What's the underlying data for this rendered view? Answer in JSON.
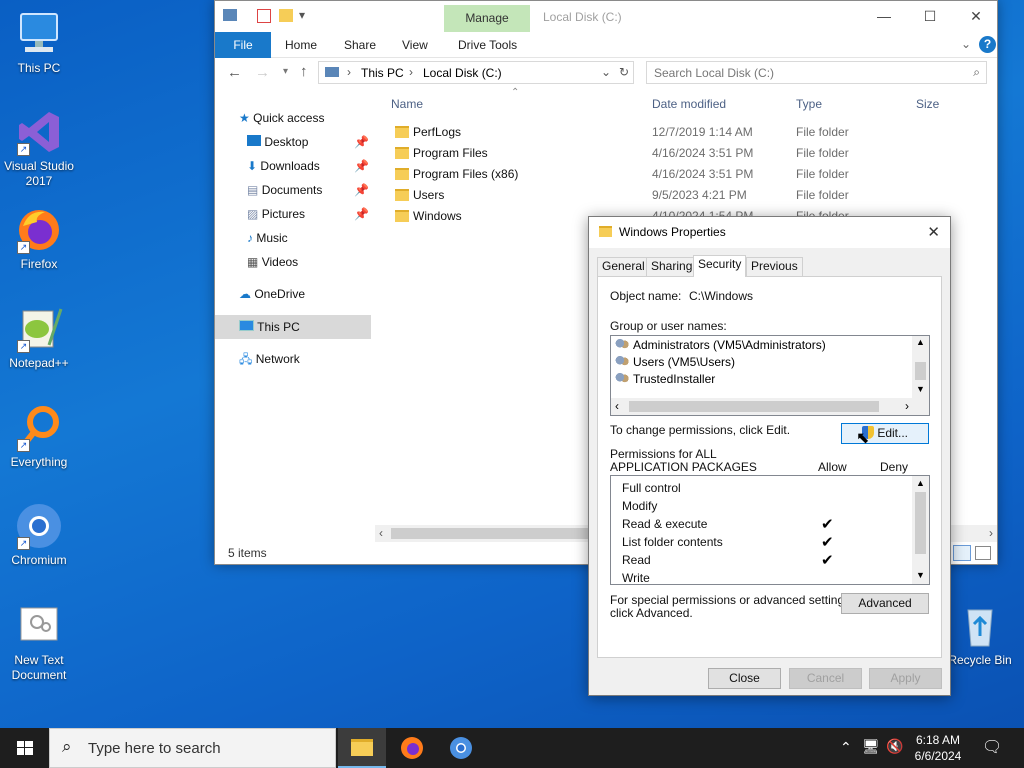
{
  "desktop": {
    "icons": [
      {
        "label": "This PC"
      },
      {
        "label": "Visual Studio 2017"
      },
      {
        "label": "Firefox"
      },
      {
        "label": "Notepad++"
      },
      {
        "label": "Everything"
      },
      {
        "label": "Chromium"
      },
      {
        "label": "New Text Document"
      },
      {
        "label": "Recycle Bin"
      }
    ]
  },
  "explorer": {
    "manage_tab": "Manage",
    "title": "Local Disk (C:)",
    "ribbon": {
      "file": "File",
      "home": "Home",
      "share": "Share",
      "view": "View",
      "drive_tools": "Drive Tools"
    },
    "address": {
      "crumb1": "This PC",
      "crumb2": "Local Disk (C:)"
    },
    "search_placeholder": "Search Local Disk (C:)",
    "nav": {
      "quick_access": "Quick access",
      "desktop": "Desktop",
      "downloads": "Downloads",
      "documents": "Documents",
      "pictures": "Pictures",
      "music": "Music",
      "videos": "Videos",
      "onedrive": "OneDrive",
      "this_pc": "This PC",
      "network": "Network"
    },
    "columns": {
      "name": "Name",
      "date": "Date modified",
      "type": "Type",
      "size": "Size"
    },
    "files": [
      {
        "name": "PerfLogs",
        "date": "12/7/2019 1:14 AM",
        "type": "File folder"
      },
      {
        "name": "Program Files",
        "date": "4/16/2024 3:51 PM",
        "type": "File folder"
      },
      {
        "name": "Program Files (x86)",
        "date": "4/16/2024 3:51 PM",
        "type": "File folder"
      },
      {
        "name": "Users",
        "date": "9/5/2023 4:21 PM",
        "type": "File folder"
      },
      {
        "name": "Windows",
        "date": "4/10/2024 1:54 PM",
        "type": "File folder"
      }
    ],
    "status": "5 items"
  },
  "dialog": {
    "title": "Windows Properties",
    "tabs": {
      "general": "General",
      "sharing": "Sharing",
      "security": "Security",
      "previous": "Previous Versions"
    },
    "object_label": "Object name:",
    "object_value": "C:\\Windows",
    "group_label": "Group or user names:",
    "users": [
      "Administrators (VM5\\Administrators)",
      "Users (VM5\\Users)",
      "TrustedInstaller"
    ],
    "change_text": "To change permissions, click Edit.",
    "edit_button": "Edit...",
    "perm_label1": "Permissions for ALL",
    "perm_label2": "APPLICATION PACKAGES",
    "allow": "Allow",
    "deny": "Deny",
    "permissions": [
      {
        "name": "Full control",
        "allow": ""
      },
      {
        "name": "Modify",
        "allow": ""
      },
      {
        "name": "Read & execute",
        "allow": "✔"
      },
      {
        "name": "List folder contents",
        "allow": "✔"
      },
      {
        "name": "Read",
        "allow": "✔"
      },
      {
        "name": "Write",
        "allow": ""
      }
    ],
    "special1": "For special permissions or advanced settings,",
    "special2": "click Advanced.",
    "advanced_button": "Advanced",
    "close_button": "Close",
    "cancel_button": "Cancel",
    "apply_button": "Apply"
  },
  "taskbar": {
    "search_placeholder": "Type here to search",
    "time": "6:18 AM",
    "date": "6/6/2024"
  }
}
